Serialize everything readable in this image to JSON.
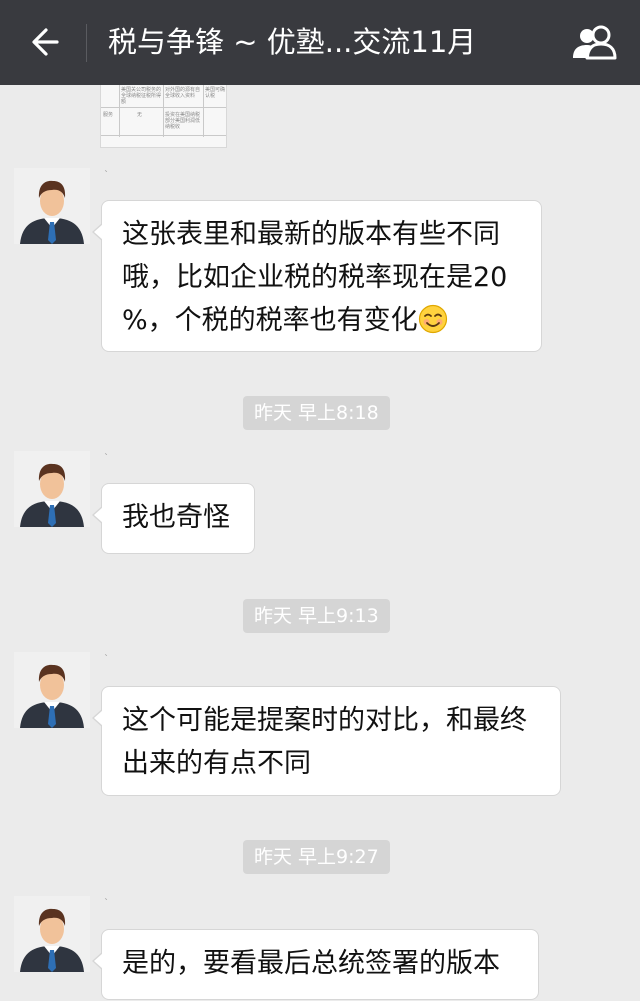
{
  "header": {
    "title": "税与争锋 ~ 优塾...交流11月",
    "back_icon": "back-arrow-icon",
    "group_icon": "group-members-icon"
  },
  "shared_image": {
    "cells": [
      "美国关公司税务的全球纳税征税所得额",
      "对外国的源有自全球收入资料",
      "美国可确认税",
      "服务",
      "无",
      "投资在美国纳税部分美国利润低纳税收"
    ]
  },
  "messages": [
    {
      "sender": "`",
      "text_lines": [
        "这张表里和最新的版本有些不同",
        "哦，比如企业税的税率现在是20",
        "%，个税的税率也有变化"
      ],
      "emoji": "smiling-face-emoji"
    },
    {
      "timestamp": "昨天 早上8:18"
    },
    {
      "sender": "`",
      "text_lines": [
        "我也奇怪"
      ]
    },
    {
      "timestamp": "昨天 早上9:13"
    },
    {
      "sender": "`",
      "text_lines": [
        "这个可能是提案时的对比，和最终",
        "出来的有点不同"
      ]
    },
    {
      "timestamp": "昨天 早上9:27"
    },
    {
      "sender": "`",
      "text_lines": [
        "是的，要看最后总统签署的版本"
      ]
    }
  ],
  "colors": {
    "header_bg": "#393a3f",
    "chat_bg": "#ebebeb",
    "bubble_bg": "#ffffff",
    "timestamp_bg": "#d5d5d5"
  }
}
